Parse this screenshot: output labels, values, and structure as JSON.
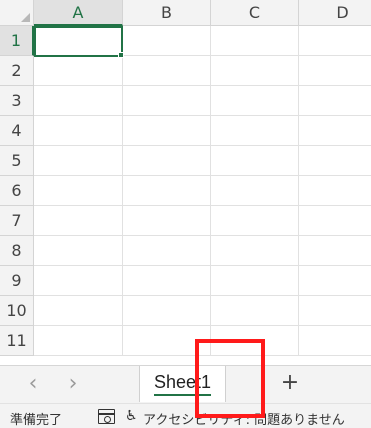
{
  "grid": {
    "columns": [
      "A",
      "B",
      "C",
      "D"
    ],
    "rows": [
      "1",
      "2",
      "3",
      "4",
      "5",
      "6",
      "7",
      "8",
      "9",
      "10",
      "11"
    ],
    "selected_cell": "A1"
  },
  "tabbar": {
    "prev_label": "‹",
    "next_label": "›",
    "sheet_name": "Sheet1",
    "add_label": "+"
  },
  "status": {
    "ready": "準備完了",
    "accessibility": "アクセシビリティ: 問題ありません"
  },
  "colors": {
    "accent": "#217346",
    "highlight": "#ff1a1a"
  },
  "icons": [
    "macro-record-icon",
    "accessibility-icon"
  ]
}
